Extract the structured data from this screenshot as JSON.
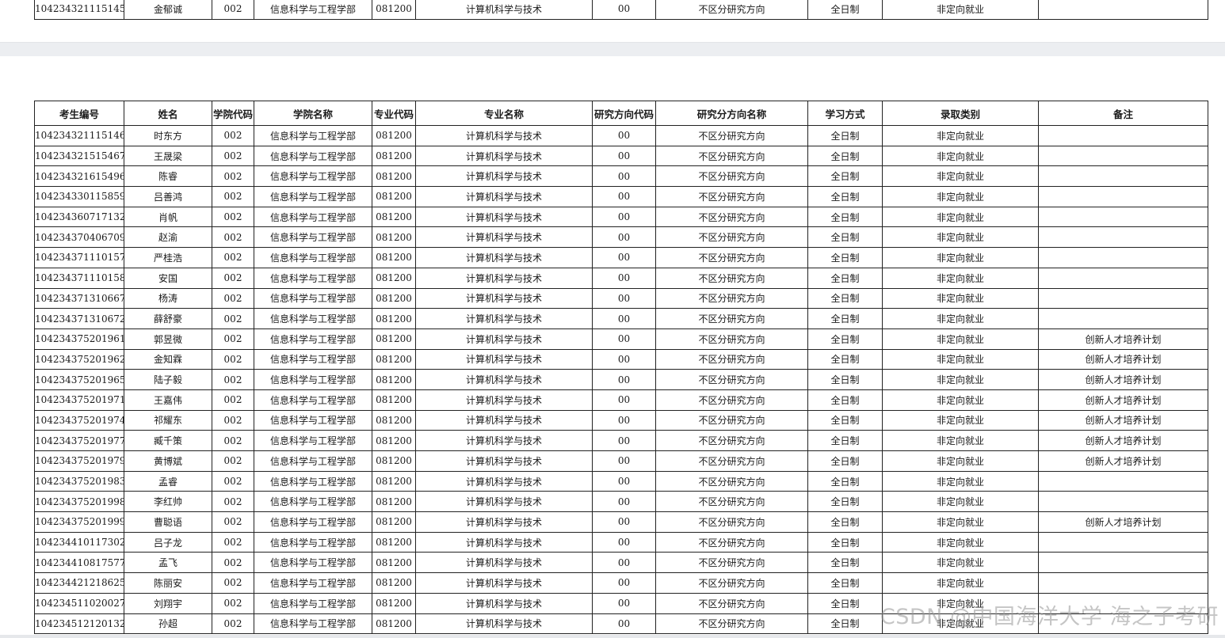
{
  "headers": [
    "考生编号",
    "姓名",
    "学院代码",
    "学院名称",
    "专业代码",
    "专业名称",
    "研究方向代码",
    "研究分方向名称",
    "学习方式",
    "录取类别",
    "备注"
  ],
  "top_row": [
    "104234321115145",
    "金郁诚",
    "002",
    "信息科学与工程学部",
    "081200",
    "计算机科学与技术",
    "00",
    "不区分研究方向",
    "全日制",
    "非定向就业",
    ""
  ],
  "rows": [
    [
      "104234321115146",
      "时东方",
      "002",
      "信息科学与工程学部",
      "081200",
      "计算机科学与技术",
      "00",
      "不区分研究方向",
      "全日制",
      "非定向就业",
      ""
    ],
    [
      "104234321515467",
      "王晟梁",
      "002",
      "信息科学与工程学部",
      "081200",
      "计算机科学与技术",
      "00",
      "不区分研究方向",
      "全日制",
      "非定向就业",
      ""
    ],
    [
      "104234321615496",
      "陈睿",
      "002",
      "信息科学与工程学部",
      "081200",
      "计算机科学与技术",
      "00",
      "不区分研究方向",
      "全日制",
      "非定向就业",
      ""
    ],
    [
      "104234330115859",
      "吕善鸿",
      "002",
      "信息科学与工程学部",
      "081200",
      "计算机科学与技术",
      "00",
      "不区分研究方向",
      "全日制",
      "非定向就业",
      ""
    ],
    [
      "104234360717132",
      "肖帆",
      "002",
      "信息科学与工程学部",
      "081200",
      "计算机科学与技术",
      "00",
      "不区分研究方向",
      "全日制",
      "非定向就业",
      ""
    ],
    [
      "104234370406709",
      "赵渝",
      "002",
      "信息科学与工程学部",
      "081200",
      "计算机科学与技术",
      "00",
      "不区分研究方向",
      "全日制",
      "非定向就业",
      ""
    ],
    [
      "104234371110157",
      "严桂浩",
      "002",
      "信息科学与工程学部",
      "081200",
      "计算机科学与技术",
      "00",
      "不区分研究方向",
      "全日制",
      "非定向就业",
      ""
    ],
    [
      "104234371110158",
      "安国",
      "002",
      "信息科学与工程学部",
      "081200",
      "计算机科学与技术",
      "00",
      "不区分研究方向",
      "全日制",
      "非定向就业",
      ""
    ],
    [
      "104234371310667",
      "杨涛",
      "002",
      "信息科学与工程学部",
      "081200",
      "计算机科学与技术",
      "00",
      "不区分研究方向",
      "全日制",
      "非定向就业",
      ""
    ],
    [
      "104234371310672",
      "薛舒豪",
      "002",
      "信息科学与工程学部",
      "081200",
      "计算机科学与技术",
      "00",
      "不区分研究方向",
      "全日制",
      "非定向就业",
      ""
    ],
    [
      "104234375201961",
      "郭昱微",
      "002",
      "信息科学与工程学部",
      "081200",
      "计算机科学与技术",
      "00",
      "不区分研究方向",
      "全日制",
      "非定向就业",
      "创新人才培养计划"
    ],
    [
      "104234375201962",
      "金知霖",
      "002",
      "信息科学与工程学部",
      "081200",
      "计算机科学与技术",
      "00",
      "不区分研究方向",
      "全日制",
      "非定向就业",
      "创新人才培养计划"
    ],
    [
      "104234375201965",
      "陆子毅",
      "002",
      "信息科学与工程学部",
      "081200",
      "计算机科学与技术",
      "00",
      "不区分研究方向",
      "全日制",
      "非定向就业",
      "创新人才培养计划"
    ],
    [
      "104234375201971",
      "王嘉伟",
      "002",
      "信息科学与工程学部",
      "081200",
      "计算机科学与技术",
      "00",
      "不区分研究方向",
      "全日制",
      "非定向就业",
      "创新人才培养计划"
    ],
    [
      "104234375201974",
      "祁耀东",
      "002",
      "信息科学与工程学部",
      "081200",
      "计算机科学与技术",
      "00",
      "不区分研究方向",
      "全日制",
      "非定向就业",
      "创新人才培养计划"
    ],
    [
      "104234375201977",
      "臧千策",
      "002",
      "信息科学与工程学部",
      "081200",
      "计算机科学与技术",
      "00",
      "不区分研究方向",
      "全日制",
      "非定向就业",
      "创新人才培养计划"
    ],
    [
      "104234375201979",
      "黄博斌",
      "002",
      "信息科学与工程学部",
      "081200",
      "计算机科学与技术",
      "00",
      "不区分研究方向",
      "全日制",
      "非定向就业",
      "创新人才培养计划"
    ],
    [
      "104234375201983",
      "孟睿",
      "002",
      "信息科学与工程学部",
      "081200",
      "计算机科学与技术",
      "00",
      "不区分研究方向",
      "全日制",
      "非定向就业",
      ""
    ],
    [
      "104234375201998",
      "李红帅",
      "002",
      "信息科学与工程学部",
      "081200",
      "计算机科学与技术",
      "00",
      "不区分研究方向",
      "全日制",
      "非定向就业",
      ""
    ],
    [
      "104234375201999",
      "曹聪语",
      "002",
      "信息科学与工程学部",
      "081200",
      "计算机科学与技术",
      "00",
      "不区分研究方向",
      "全日制",
      "非定向就业",
      "创新人才培养计划"
    ],
    [
      "104234410117302",
      "吕子龙",
      "002",
      "信息科学与工程学部",
      "081200",
      "计算机科学与技术",
      "00",
      "不区分研究方向",
      "全日制",
      "非定向就业",
      ""
    ],
    [
      "104234410817577",
      "孟飞",
      "002",
      "信息科学与工程学部",
      "081200",
      "计算机科学与技术",
      "00",
      "不区分研究方向",
      "全日制",
      "非定向就业",
      ""
    ],
    [
      "104234421218625",
      "陈丽安",
      "002",
      "信息科学与工程学部",
      "081200",
      "计算机科学与技术",
      "00",
      "不区分研究方向",
      "全日制",
      "非定向就业",
      ""
    ],
    [
      "104234511020027",
      "刘翔宇",
      "002",
      "信息科学与工程学部",
      "081200",
      "计算机科学与技术",
      "00",
      "不区分研究方向",
      "全日制",
      "非定向就业",
      ""
    ],
    [
      "104234512120132",
      "孙超",
      "002",
      "信息科学与工程学部",
      "081200",
      "计算机科学与技术",
      "00",
      "不区分研究方向",
      "全日制",
      "非定向就业",
      ""
    ]
  ],
  "watermark": "CSDN @中国海洋大学 海之子考研"
}
